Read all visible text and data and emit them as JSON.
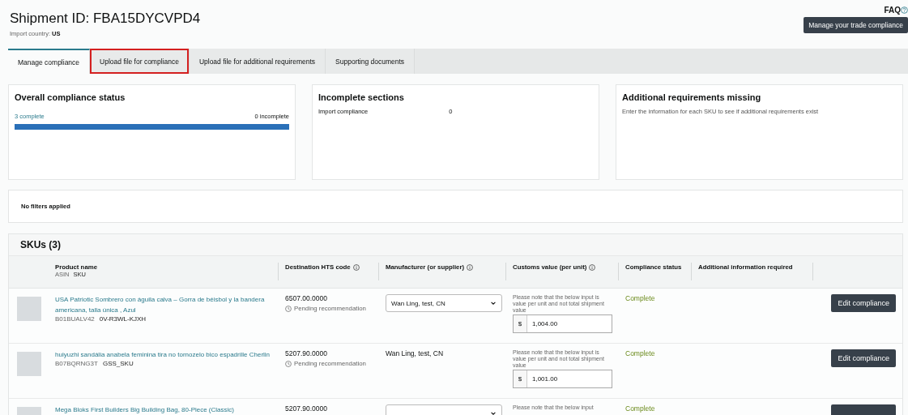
{
  "header": {
    "title": "Shipment ID: FBA15DYCVPD4",
    "country_label": "Import country:",
    "country": "US",
    "faq": "FAQ",
    "manage_button": "Manage your trade compliance"
  },
  "tabs": [
    {
      "label": "Manage compliance",
      "selected": true,
      "highlighted": false
    },
    {
      "label": "Upload file for compliance",
      "selected": false,
      "highlighted": true
    },
    {
      "label": "Upload file for additional requirements",
      "selected": false,
      "highlighted": false
    },
    {
      "label": "Supporting documents",
      "selected": false,
      "highlighted": false
    }
  ],
  "cards": [
    {
      "kind": "progress",
      "title": "Overall compliance status",
      "left": "3 complete",
      "right": "0 incomplete",
      "level": 1
    },
    {
      "kind": "pairs",
      "title": "Incomplete sections",
      "label": "Import compliance",
      "value": "0"
    },
    {
      "kind": "note",
      "title": "Additional requirements missing",
      "text": "Enter the information for each SKU to see if additional requirements exist"
    }
  ],
  "filters": "No filters applied",
  "skus": {
    "title": "SKUs (3)",
    "columns": [
      {
        "label": "Product name",
        "sub1": "ASIN",
        "sub2": "SKU",
        "info": false
      },
      {
        "label": "Destination HTS code",
        "info": true
      },
      {
        "label": "Manufacturer (or supplier)",
        "info": true
      },
      {
        "label": "Customs value (per unit)",
        "info": true
      },
      {
        "label": "Compliance status",
        "info": false
      },
      {
        "label": "Additional information required",
        "info": false
      }
    ],
    "rows": [
      {
        "name": "USA Patriotic Sombrero con águila calva – Gorra de béisbol y la bandera americana, talla única , Azul",
        "asin": "B01BUALV42",
        "sku": "0V-R3WL-KJXH",
        "hts": "6507.00.0000",
        "hts_status": "Pending recommendation",
        "manufacturer": {
          "kind": "select",
          "value": "Wan Ling, test, CN"
        },
        "note": "Please note that the below input is value per unit and not total shipment value",
        "currency": "$",
        "value": "1,004.00",
        "status": "Complete",
        "button": "Edit compliance"
      },
      {
        "name": "huiyuzhi sandália anabela feminina tira no tornozelo bico espadrille Cherlin",
        "asin": "B07BQRNG3T",
        "sku": "GSS_SKU",
        "hts": "5207.90.0000",
        "hts_status": "Pending recommendation",
        "manufacturer": {
          "kind": "text",
          "value": "Wan Ling, test, CN"
        },
        "note": "Please note that the below input is value per unit and not total shipment value",
        "currency": "$",
        "value": "1,001.00",
        "status": "Complete",
        "button": "Edit compliance"
      },
      {
        "name": "Mega Bloks First Builders Big Building Bag, 80-Piece (Classic)",
        "hts": "5207.90.0000",
        "manufacturer": {
          "kind": "select"
        },
        "note": "Please note that the below input",
        "status": "Complete"
      }
    ]
  }
}
